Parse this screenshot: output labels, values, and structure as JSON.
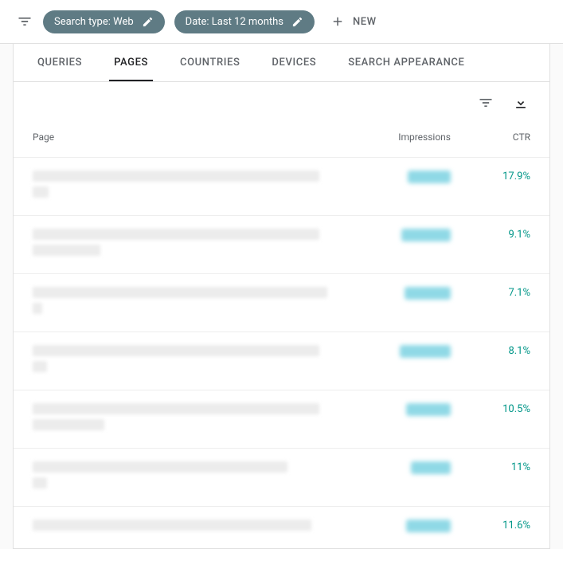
{
  "topbar": {
    "chip_search_type": "Search type: Web",
    "chip_date": "Date: Last 12 months",
    "new_label": "NEW"
  },
  "tabs": {
    "queries": "QUERIES",
    "pages": "PAGES",
    "countries": "COUNTRIES",
    "devices": "DEVICES",
    "search_appearance": "SEARCH APPEARANCE"
  },
  "columns": {
    "page": "Page",
    "impressions": "Impressions",
    "ctr": "CTR"
  },
  "rows": [
    {
      "page_w1": 360,
      "page_w2": 20,
      "imp_w": 54,
      "ctr": "17.9%"
    },
    {
      "page_w1": 360,
      "page_w2": 85,
      "imp_w": 62,
      "ctr": "9.1%"
    },
    {
      "page_w1": 370,
      "page_w2": 12,
      "imp_w": 58,
      "ctr": "7.1%"
    },
    {
      "page_w1": 360,
      "page_w2": 18,
      "imp_w": 64,
      "ctr": "8.1%"
    },
    {
      "page_w1": 360,
      "page_w2": 90,
      "imp_w": 56,
      "ctr": "10.5%"
    },
    {
      "page_w1": 320,
      "page_w2": 18,
      "imp_w": 50,
      "ctr": "11%"
    },
    {
      "page_w1": 350,
      "page_w2": 0,
      "imp_w": 56,
      "ctr": "11.6%"
    }
  ]
}
